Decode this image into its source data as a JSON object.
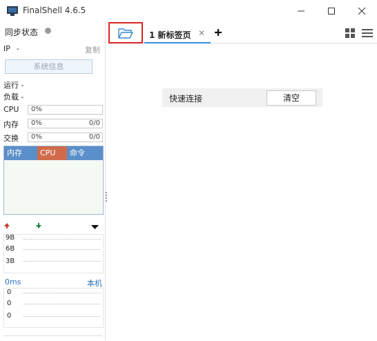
{
  "window": {
    "title": "FinalShell 4.6.5"
  },
  "left": {
    "sync_label": "同步状态",
    "ip_label": "IP",
    "ip_value": "-",
    "copy_label": "复制",
    "sysinfo_button": "系统信息",
    "running_label": "运行 -",
    "load_label": "负载 -",
    "cpu": {
      "label": "CPU",
      "pct": "0%"
    },
    "memory": {
      "label": "内存",
      "pct": "0%",
      "amount": "0/0"
    },
    "swap": {
      "label": "交换",
      "pct": "0%",
      "amount": "0/0"
    },
    "process_table": {
      "headers": [
        "内存",
        "CPU",
        "命令"
      ],
      "colors": [
        "#5b8fc9",
        "#d06b4c",
        "#5b8fc9"
      ]
    },
    "net": {
      "levels": [
        "9B",
        "6B",
        "3B"
      ]
    },
    "ping": {
      "latency": "0ms",
      "host": "本机",
      "values": [
        "0",
        "0",
        "0"
      ]
    }
  },
  "tabs": [
    {
      "label": "1 新标签页"
    }
  ],
  "quick_connect": {
    "label": "快速连接",
    "clear_button": "清空"
  }
}
